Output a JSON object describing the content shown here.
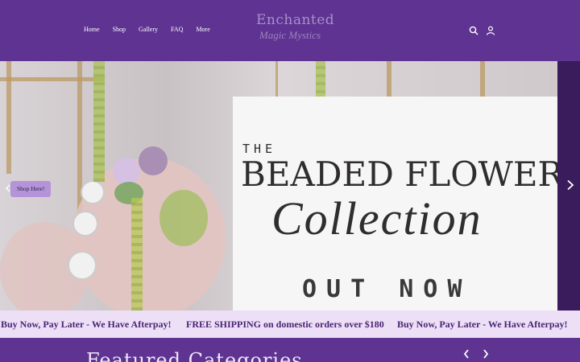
{
  "nav": {
    "items": [
      "Home",
      "Shop",
      "Gallery",
      "FAQ",
      "More"
    ]
  },
  "logo": {
    "line1": "Enchanted",
    "line2": "Magic Mystics"
  },
  "icons": {
    "search": "search-icon",
    "account": "user-icon",
    "next": "chevron-right-icon",
    "prev": "chevron-left-icon"
  },
  "hero": {
    "the": "THE",
    "headline": "BEADED FLOWER",
    "script": "Collection",
    "tagline": "OUT NOW",
    "shop_button": "Shop Here!"
  },
  "marquee": {
    "items": [
      "Buy Now, Pay Later - We Have Afterpay!",
      "FREE SHIPPING on domestic orders over $180",
      "Buy Now, Pay Later - We Have Afterpay!"
    ]
  },
  "featured": {
    "title": "Featured Categories"
  },
  "colors": {
    "brand": "#5e3392",
    "accent": "#b493d9",
    "banner": "#ecdff6"
  }
}
